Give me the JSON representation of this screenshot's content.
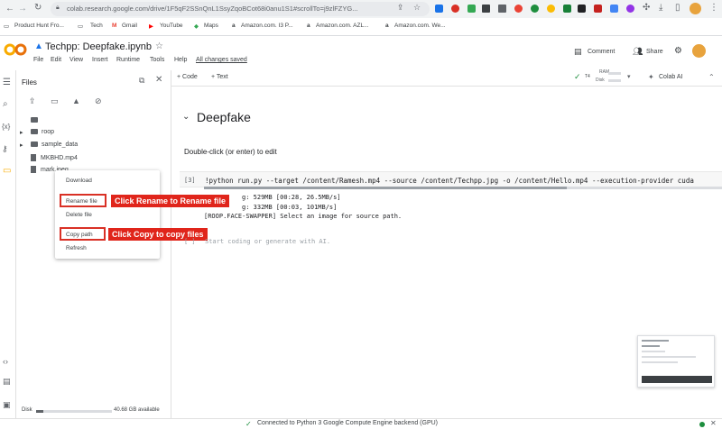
{
  "browser": {
    "url": "colab.research.google.com/drive/1F5qF2SSnQnL1SsyZqoBCot68i0anu1S1#scrollTo=j9zlFZYG...",
    "bookmarks": [
      "Product Hunt Fro...",
      "Tech",
      "Gmail",
      "YouTube",
      "Maps",
      "Amazon.com. I3 P...",
      "Amazon.com. AZL...",
      "Amazon.com. We..."
    ]
  },
  "notebook": {
    "title": "Techpp: Deepfake.ipynb",
    "menu": [
      "File",
      "Edit",
      "View",
      "Insert",
      "Runtime",
      "Tools",
      "Help"
    ],
    "saved_status": "All changes saved",
    "comment_label": "Comment",
    "share_label": "Share",
    "add_code": "+ Code",
    "add_text": "+ Text",
    "ram_label": "RAM",
    "disk_label": "Disk",
    "colab_ai": "Colab AI"
  },
  "files_panel": {
    "title": "Files",
    "tree": [
      {
        "name": "roop",
        "kind": "folder"
      },
      {
        "name": "sample_data",
        "kind": "folder"
      },
      {
        "name": "MKBHD.mp4",
        "kind": "file"
      },
      {
        "name": "mark.jpeg",
        "kind": "file"
      }
    ],
    "disk_label": "Disk",
    "disk_available": "40.68 GB available"
  },
  "context_menu": [
    "Download",
    "Rename file",
    "Delete file",
    "Copy path",
    "Refresh"
  ],
  "callouts": {
    "rename": "Click Rename to Rename file",
    "copy": "Click Copy to copy files"
  },
  "cells": {
    "section_title": "Deepfake",
    "section_text": "Double-click (or enter) to edit",
    "code_index": "[3]",
    "code_line": "!python run.py --target /content/Ramesh.mp4  --source /content/Techpp.jpg -o /content/Hello.mp4 --execution-provider cuda",
    "output_lines": [
      "g: 529MB [00:28, 26.5MB/s]",
      "g: 332MB [00:03, 101MB/s]",
      "[ROOP.FACE-SWAPPER] Select an image for source path."
    ],
    "empty_cell_index": "[ ]",
    "empty_cell_placeholder": "Start coding or generate with AI."
  },
  "status_bar": {
    "connection": "Connected to Python 3 Google Compute Engine backend (GPU)"
  },
  "colors": {
    "accent_orange": "#f9ab00",
    "callout_red": "#e0251b",
    "status_green": "#1e8e3e"
  }
}
